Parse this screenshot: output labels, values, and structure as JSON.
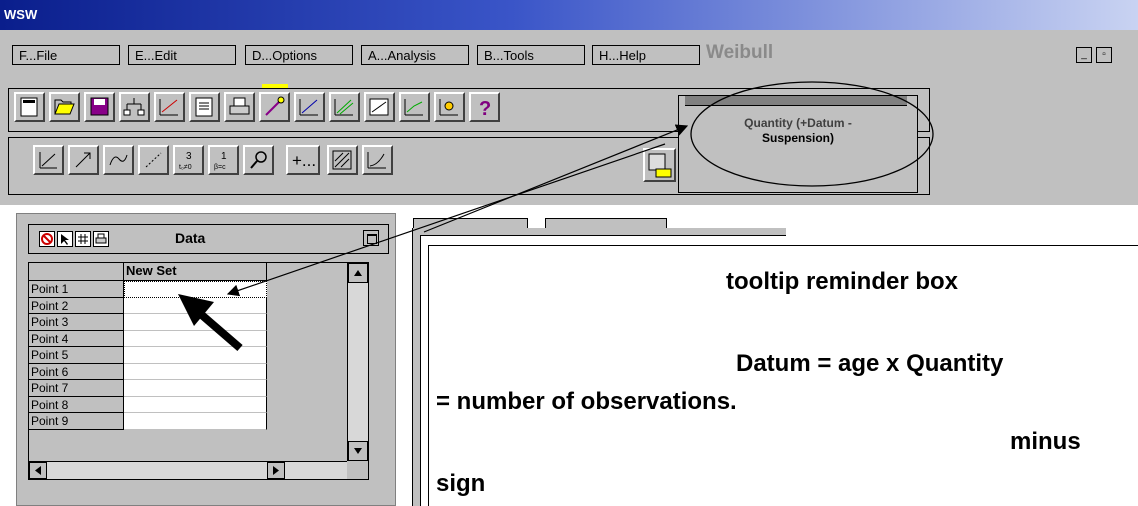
{
  "window": {
    "title": "WSW",
    "app_name": "Weibull"
  },
  "menu": [
    {
      "id": "file",
      "label": "F...File"
    },
    {
      "id": "edit",
      "label": "E...Edit"
    },
    {
      "id": "options",
      "label": "D...Options"
    },
    {
      "id": "analysis",
      "label": "A...Analysis"
    },
    {
      "id": "tools",
      "label": "B...Tools"
    },
    {
      "id": "help",
      "label": "H...Help"
    }
  ],
  "window_controls": {
    "minimize": "_",
    "maximize": "▫"
  },
  "tooltip": {
    "line1": "Quantity (+Datum -",
    "line2": "Suspension)"
  },
  "data_window": {
    "title": "Data",
    "column_header": "New Set",
    "rows": [
      "Point 1",
      "Point 2",
      "Point 3",
      "Point 4",
      "Point 5",
      "Point 6",
      "Point 7",
      "Point 8",
      "Point 9"
    ]
  },
  "toolbar2": {
    "plus_label": "+..."
  },
  "annotations": {
    "line1": "tooltip reminder box",
    "line2": "Datum = age x Quantity",
    "line3": "= number of observations.",
    "line4": "minus",
    "line5": "sign"
  },
  "colors": {
    "face": "#c0c0c0",
    "title_start": "#0a1e8c",
    "title_end": "#c9d3f2",
    "help_icon": "#800080",
    "stop_icon": "#cc0000"
  }
}
